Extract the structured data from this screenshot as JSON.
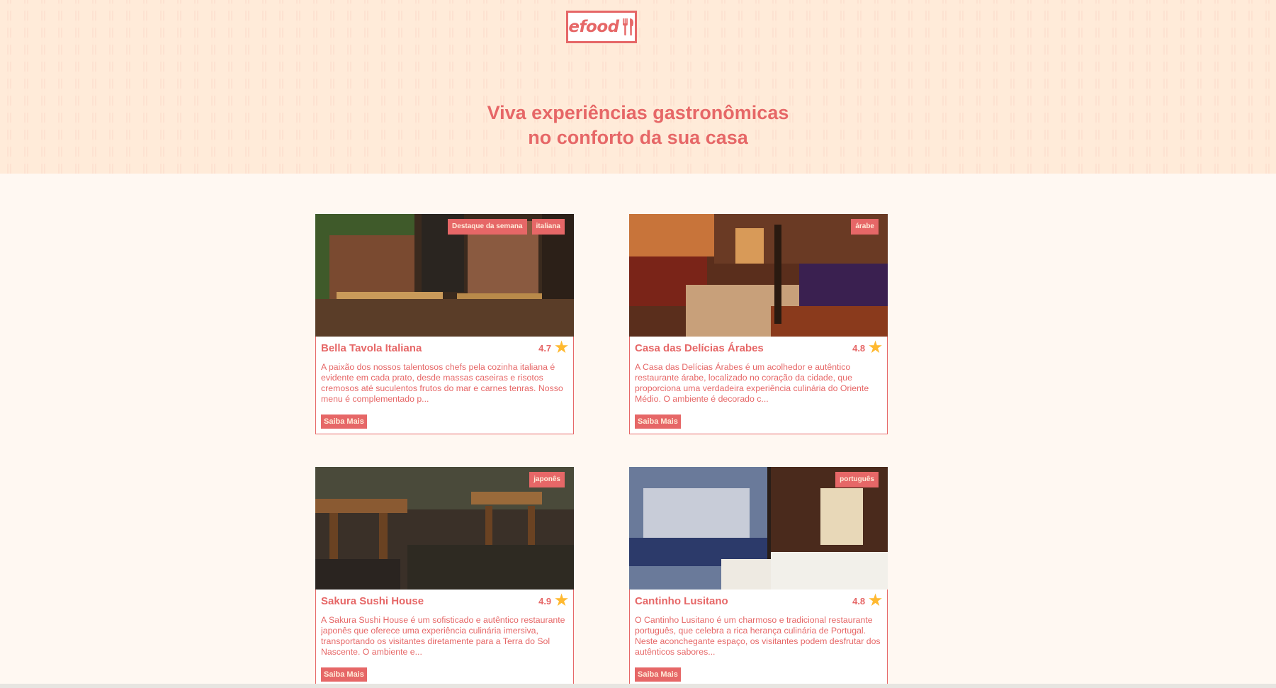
{
  "header": {
    "logo_text": "efood",
    "title_line1": "Viva experiências gastronômicas",
    "title_line2": "no conforto da sua casa"
  },
  "colors": {
    "primary": "#e66767",
    "hero_bg": "#ffebd9",
    "page_bg": "#fff8f2",
    "star": "#ffb930"
  },
  "restaurants": [
    {
      "name": "Bella Tavola Italiana",
      "rating": "4.7",
      "tags": [
        "Destaque da semana",
        "italiana"
      ],
      "description": "A paixão dos nossos talentosos chefs pela cozinha italiana é evidente em cada prato, desde massas caseiras e risotos cremosos até suculentos frutos do mar e carnes tenras. Nosso menu é complementado p...",
      "button": "Saiba Mais"
    },
    {
      "name": "Casa das Delícias Árabes",
      "rating": "4.8",
      "tags": [
        "árabe"
      ],
      "description": "A Casa das Delícias Árabes é um acolhedor e autêntico restaurante árabe, localizado no coração da cidade, que proporciona uma verdadeira experiência culinária do Oriente Médio. O ambiente é decorado c...",
      "button": "Saiba Mais"
    },
    {
      "name": "Sakura Sushi House",
      "rating": "4.9",
      "tags": [
        "japonês"
      ],
      "description": "A Sakura Sushi House é um sofisticado e autêntico restaurante japonês que oferece uma experiência culinária imersiva, transportando os visitantes diretamente para a Terra do Sol Nascente. O ambiente e...",
      "button": "Saiba Mais"
    },
    {
      "name": "Cantinho Lusitano",
      "rating": "4.8",
      "tags": [
        "português"
      ],
      "description": "O Cantinho Lusitano é um charmoso e tradicional restaurante português, que celebra a rica herança culinária de Portugal. Neste aconchegante espaço, os visitantes podem desfrutar dos autênticos sabores...",
      "button": "Saiba Mais"
    }
  ]
}
